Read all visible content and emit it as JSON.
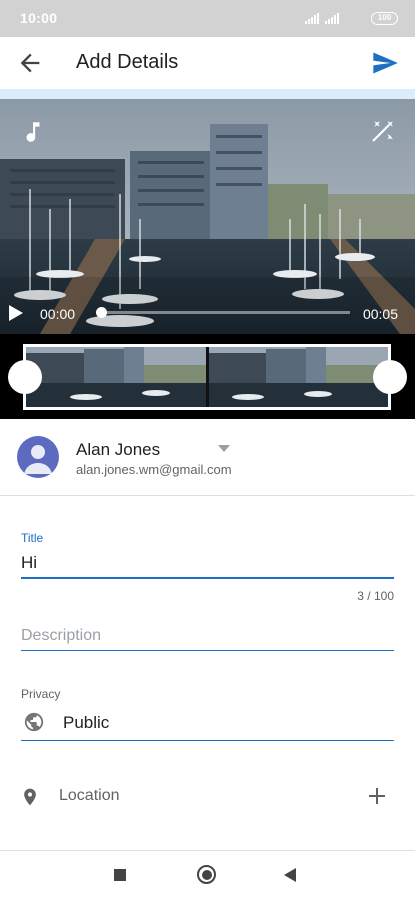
{
  "status_bar": {
    "time": "10:00",
    "battery": "100",
    "icons": [
      "signal-icon",
      "signal-icon",
      "battery-icon"
    ]
  },
  "app_bar": {
    "title": "Add Details",
    "back_icon": "arrow-back-icon",
    "send_icon": "send-icon",
    "accent_color": "#1e6fc4"
  },
  "video": {
    "current_time": "00:00",
    "duration": "00:05",
    "progress": 0,
    "music_icon": "music-note-icon",
    "effects_icon": "magic-wand-icon",
    "play_icon": "play-icon"
  },
  "account": {
    "name": "Alan Jones",
    "email": "alan.jones.wm@gmail.com"
  },
  "form": {
    "title_label": "Title",
    "title_value": "Hi",
    "title_counter": "3 / 100",
    "description_placeholder": "Description",
    "privacy_label": "Privacy",
    "privacy_value": "Public",
    "location_label": "Location"
  },
  "nav_bar": {
    "icons": [
      "recents-icon",
      "home-icon",
      "back-icon"
    ]
  }
}
